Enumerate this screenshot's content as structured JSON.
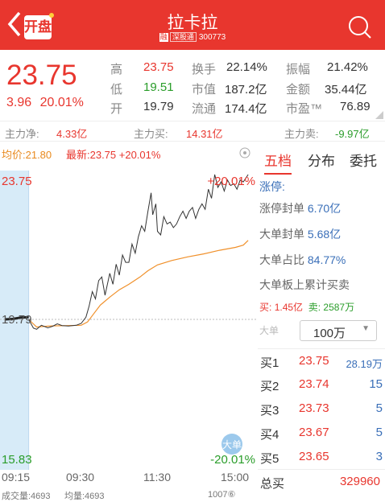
{
  "header": {
    "open_label": "开盘",
    "name": "拉卡拉",
    "tag_margin": "融",
    "tag_connect": "深股通",
    "code": "300773"
  },
  "quote": {
    "price": "23.75",
    "change": "3.96",
    "change_pct": "20.01%"
  },
  "stats": [
    {
      "label": "高",
      "value": "23.75",
      "color": "red"
    },
    {
      "label": "换手",
      "value": "22.14%"
    },
    {
      "label": "振幅",
      "value": "21.42%"
    },
    {
      "label": "低",
      "value": "19.51",
      "color": "grn"
    },
    {
      "label": "市值",
      "value": "187.2亿"
    },
    {
      "label": "金额",
      "value": "35.44亿"
    },
    {
      "label": "开",
      "value": "19.79"
    },
    {
      "label": "流通",
      "value": "174.4亿"
    },
    {
      "label": "市盈™",
      "value": "76.89"
    }
  ],
  "flow": {
    "net_label": "主力净:",
    "net": "4.33亿",
    "buy_label": "主力买:",
    "buy": "14.31亿",
    "sell_label": "主力卖:",
    "sell": "-9.97亿"
  },
  "chart_info": {
    "avg_label": "均价:21.80",
    "latest_label": "最新:23.75 +20.01%"
  },
  "chart_data": {
    "type": "line",
    "y_max": "23.75",
    "y_prev": "19.79",
    "y_min": "15.83",
    "pct_max": "+20.01%",
    "pct_min": "-20.01%",
    "ylim": [
      15.83,
      23.75
    ],
    "x_ticks": [
      "09:15",
      "09:30",
      "11:30",
      "15:00"
    ],
    "preopen": [
      [
        0,
        19.79
      ],
      [
        5,
        19.8
      ],
      [
        10,
        19.84
      ],
      [
        15,
        19.85
      ]
    ],
    "price": [
      [
        15,
        19.79
      ],
      [
        18,
        19.55
      ],
      [
        20,
        19.52
      ],
      [
        23,
        19.63
      ],
      [
        27,
        19.56
      ],
      [
        30,
        19.6
      ],
      [
        33,
        19.67
      ],
      [
        36,
        19.62
      ],
      [
        40,
        19.61
      ],
      [
        45,
        19.63
      ],
      [
        48,
        19.68
      ],
      [
        51,
        19.85
      ],
      [
        53,
        20.15
      ],
      [
        55,
        20.55
      ],
      [
        57,
        20.35
      ],
      [
        59,
        20.85
      ],
      [
        61,
        20.95
      ],
      [
        63,
        20.45
      ],
      [
        66,
        21.05
      ],
      [
        68,
        20.75
      ],
      [
        70,
        21.3
      ],
      [
        72,
        21.0
      ],
      [
        74,
        21.55
      ],
      [
        76,
        21.35
      ],
      [
        78,
        21.35
      ],
      [
        80,
        21.85
      ],
      [
        82,
        21.6
      ],
      [
        84,
        22.05
      ],
      [
        86,
        22.35
      ],
      [
        88,
        22.2
      ],
      [
        90,
        22.75
      ],
      [
        92,
        23.25
      ],
      [
        93,
        22.65
      ],
      [
        95,
        22.95
      ],
      [
        96,
        22.2
      ],
      [
        98,
        22.1
      ],
      [
        100,
        22.6
      ],
      [
        102,
        22.4
      ],
      [
        104,
        22.45
      ],
      [
        106,
        22.3
      ],
      [
        108,
        22.4
      ],
      [
        110,
        22.6
      ],
      [
        112,
        22.75
      ],
      [
        114,
        22.55
      ],
      [
        116,
        22.75
      ],
      [
        118,
        22.85
      ],
      [
        120,
        22.55
      ],
      [
        122,
        22.8
      ],
      [
        124,
        22.95
      ],
      [
        126,
        22.8
      ],
      [
        128,
        23.35
      ],
      [
        130,
        23.1
      ],
      [
        132,
        23.75
      ],
      [
        134,
        23.4
      ],
      [
        136,
        23.55
      ],
      [
        138,
        23.3
      ],
      [
        140,
        23.6
      ],
      [
        142,
        23.45
      ],
      [
        144,
        23.5
      ],
      [
        146,
        23.35
      ],
      [
        148,
        23.6
      ],
      [
        150,
        23.55
      ],
      [
        153,
        23.75
      ]
    ],
    "avg": [
      [
        15,
        19.79
      ],
      [
        20,
        19.58
      ],
      [
        28,
        19.61
      ],
      [
        40,
        19.62
      ],
      [
        48,
        19.63
      ],
      [
        52,
        19.72
      ],
      [
        56,
        19.95
      ],
      [
        60,
        20.18
      ],
      [
        66,
        20.4
      ],
      [
        72,
        20.6
      ],
      [
        78,
        20.75
      ],
      [
        85,
        20.95
      ],
      [
        90,
        21.12
      ],
      [
        96,
        21.28
      ],
      [
        105,
        21.4
      ],
      [
        115,
        21.5
      ],
      [
        125,
        21.58
      ],
      [
        135,
        21.68
      ],
      [
        145,
        21.76
      ],
      [
        150,
        21.82
      ],
      [
        153,
        21.95
      ]
    ],
    "badge": "大单"
  },
  "tabs": [
    "五档",
    "分布",
    "委托"
  ],
  "panel": {
    "limit_up": "涨停:",
    "seal_label": "涨停封单",
    "seal": "6.70亿",
    "big_label": "大单封单",
    "big": "5.68亿",
    "ratio_label": "大单占比",
    "ratio": "84.77%",
    "acc_label": "大单板上累计买卖",
    "buy_label": "买:",
    "buy": "1.45亿",
    "sell_label": "卖:",
    "sell": "2587万",
    "filter_label": "大单",
    "filter_value": "100万"
  },
  "book": [
    {
      "label": "买1",
      "price": "23.75",
      "vol": "28.19万"
    },
    {
      "label": "买2",
      "price": "23.74",
      "vol": "15"
    },
    {
      "label": "买3",
      "price": "23.73",
      "vol": "5"
    },
    {
      "label": "买4",
      "price": "23.67",
      "vol": "5"
    },
    {
      "label": "买5",
      "price": "23.65",
      "vol": "3"
    }
  ],
  "total": {
    "label": "总买",
    "value": "329960"
  },
  "bottom": {
    "vol_label": "成交量:4693",
    "avg_vol": "均量:4693",
    "extra": "1007⑥"
  }
}
